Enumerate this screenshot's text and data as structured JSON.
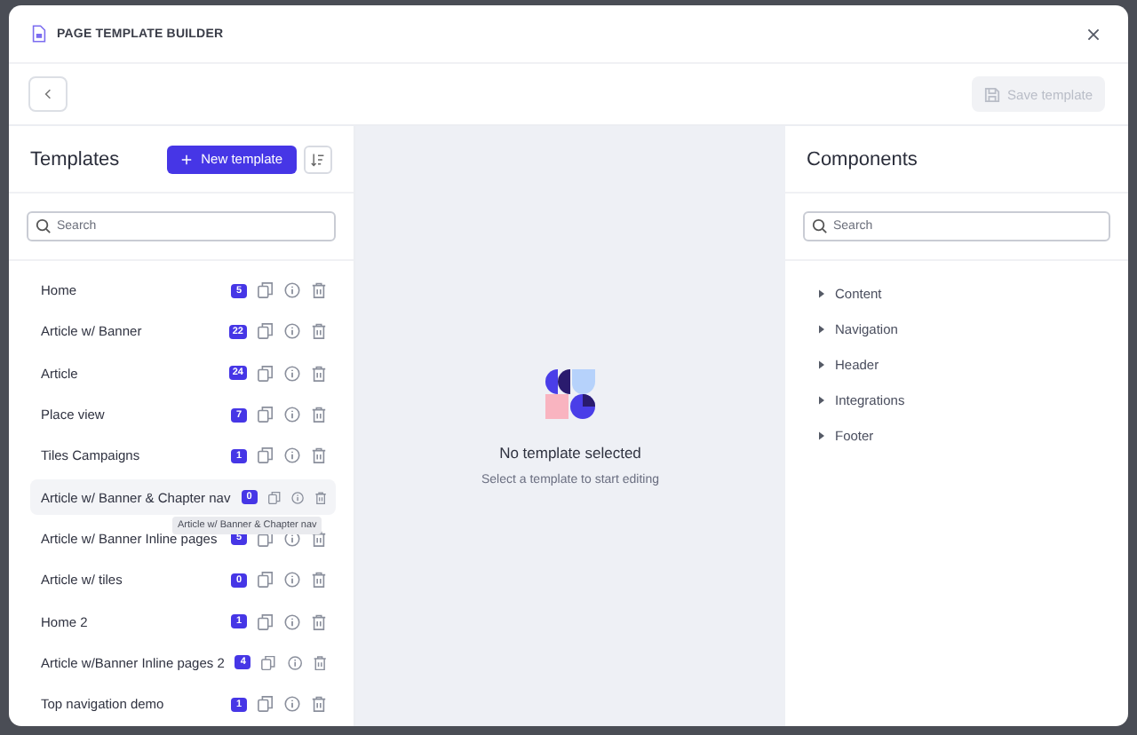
{
  "window": {
    "title": "PAGE TEMPLATE BUILDER"
  },
  "toolbar": {
    "save_button": {
      "label": "Save template",
      "disabled": true
    }
  },
  "templates_panel": {
    "title": "Templates",
    "new_button": "New template",
    "search": {
      "placeholder": "Search"
    },
    "items": [
      {
        "name": "Home",
        "count": "5",
        "hovered": false
      },
      {
        "name": "Article w/ Banner",
        "count": "22",
        "hovered": false
      },
      {
        "name": "Article",
        "count": "24",
        "hovered": false
      },
      {
        "name": "Place view",
        "count": "7",
        "hovered": false
      },
      {
        "name": "Tiles Campaigns",
        "count": "1",
        "hovered": false
      },
      {
        "name": "Article w/ Banner & Chapter nav",
        "count": "0",
        "hovered": true,
        "tooltip": "Article w/ Banner & Chapter nav"
      },
      {
        "name": "Article w/ Banner Inline pages",
        "count": "5",
        "hovered": false
      },
      {
        "name": "Article w/ tiles",
        "count": "0",
        "hovered": false
      },
      {
        "name": "Home 2",
        "count": "1",
        "hovered": false
      },
      {
        "name": "Article w/Banner Inline pages 2",
        "count": "4",
        "hovered": false
      },
      {
        "name": "Top navigation demo",
        "count": "1",
        "hovered": false
      }
    ]
  },
  "empty_state": {
    "title": "No template selected",
    "message": "Select a template to start editing"
  },
  "components_panel": {
    "title": "Components",
    "search": {
      "placeholder": "Search"
    },
    "groups": [
      {
        "label": "Content",
        "expanded": false
      },
      {
        "label": "Navigation",
        "expanded": false
      },
      {
        "label": "Header",
        "expanded": false
      },
      {
        "label": "Integrations",
        "expanded": false
      },
      {
        "label": "Footer",
        "expanded": false
      }
    ]
  }
}
